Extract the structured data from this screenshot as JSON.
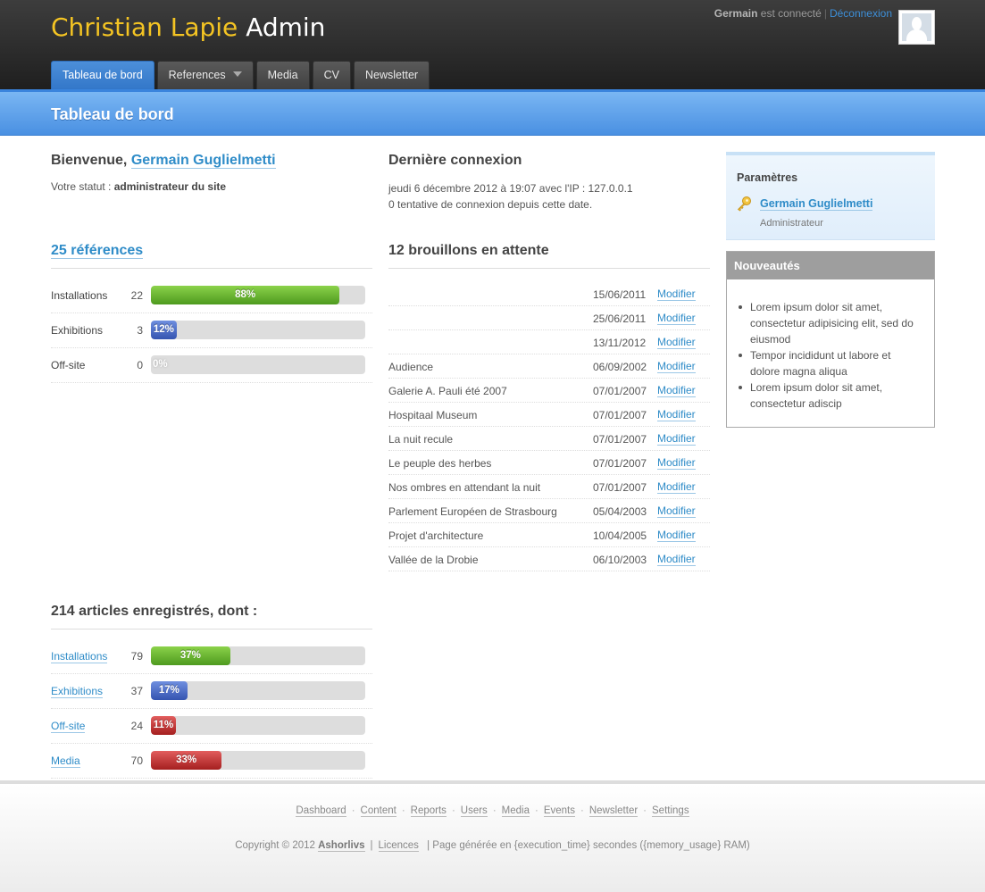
{
  "header": {
    "logo_part1": "Christian Lapie",
    "logo_part2": "Admin",
    "user_name": "Germain",
    "user_status": "est connecté",
    "logout": "Déconnexion"
  },
  "nav": {
    "tabs": [
      "Tableau de bord",
      "References",
      "Media",
      "CV",
      "Newsletter"
    ]
  },
  "page_title": "Tableau de bord",
  "welcome": {
    "prefix": "Bienvenue,",
    "name": "Germain Guglielmetti",
    "status_label": "Votre statut :",
    "status_value": "administrateur du site"
  },
  "last_login": {
    "title": "Dernière connexion",
    "line1": "jeudi 6 décembre 2012 à 19:07 avec l'IP : 127.0.0.1",
    "line2": "0 tentative de connexion depuis cette date."
  },
  "references": {
    "title": "25 références",
    "rows": [
      {
        "label": "Installations",
        "count": "22",
        "percent": 88,
        "percent_text": "88%",
        "color": "green"
      },
      {
        "label": "Exhibitions",
        "count": "3",
        "percent": 12,
        "percent_text": "12%",
        "color": "blue"
      },
      {
        "label": "Off-site",
        "count": "0",
        "percent": 0,
        "percent_text": "0%",
        "color": "gray"
      }
    ]
  },
  "drafts": {
    "title": "12 brouillons en attente",
    "modify_label": "Modifier",
    "rows": [
      {
        "title": "",
        "date": "15/06/2011"
      },
      {
        "title": "",
        "date": "25/06/2011"
      },
      {
        "title": "",
        "date": "13/11/2012"
      },
      {
        "title": "Audience",
        "date": "06/09/2002"
      },
      {
        "title": "Galerie A. Pauli été 2007",
        "date": "07/01/2007"
      },
      {
        "title": "Hospitaal Museum",
        "date": "07/01/2007"
      },
      {
        "title": "La nuit recule",
        "date": "07/01/2007"
      },
      {
        "title": "Le peuple des herbes",
        "date": "07/01/2007"
      },
      {
        "title": "Nos ombres en attendant la nuit",
        "date": "07/01/2007"
      },
      {
        "title": "Parlement Européen de Strasbourg",
        "date": "05/04/2003"
      },
      {
        "title": "Projet d'architecture",
        "date": "10/04/2005"
      },
      {
        "title": "Vallée de la Drobie",
        "date": "06/10/2003"
      }
    ]
  },
  "articles": {
    "title": "214 articles enregistrés, dont :",
    "rows": [
      {
        "label": "Installations",
        "count": "79",
        "percent": 37,
        "percent_text": "37%",
        "color": "green"
      },
      {
        "label": "Exhibitions",
        "count": "37",
        "percent": 17,
        "percent_text": "17%",
        "color": "blue"
      },
      {
        "label": "Off-site",
        "count": "24",
        "percent": 11,
        "percent_text": "11%",
        "color": "red"
      },
      {
        "label": "Media",
        "count": "70",
        "percent": 33,
        "percent_text": "33%",
        "color": "red"
      }
    ]
  },
  "params": {
    "title": "Paramètres",
    "name": "Germain Guglielmetti",
    "role": "Administrateur",
    "icon": "key-icon"
  },
  "news": {
    "title": "Nouveautés",
    "items": [
      "Lorem ipsum dolor sit amet, consectetur adipisicing elit, sed do eiusmod",
      "Tempor incididunt ut labore et dolore magna aliqua",
      "Lorem ipsum dolor sit amet, consectetur adiscip"
    ]
  },
  "footer": {
    "links": [
      "Dashboard",
      "Content",
      "Reports",
      "Users",
      "Media",
      "Events",
      "Newsletter",
      "Settings"
    ],
    "copyright": "Copyright © 2012",
    "company": "Ashorlivs",
    "licences": "Licences",
    "generated": "| Page générée en {execution_time} secondes ({memory_usage} RAM)"
  }
}
